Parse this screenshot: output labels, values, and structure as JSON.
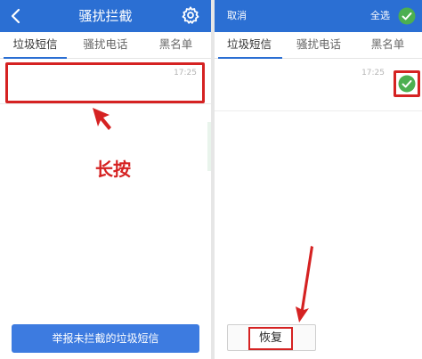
{
  "left_screen": {
    "header": {
      "title": "骚扰拦截",
      "back_icon": "chevron-left-icon",
      "settings_icon": "gear-icon"
    },
    "tabs": [
      {
        "label": "垃圾短信",
        "active": true
      },
      {
        "label": "骚扰电话",
        "active": false
      },
      {
        "label": "黑名单",
        "active": false
      }
    ],
    "message": {
      "time": "17:25"
    },
    "annotation": {
      "text": "长按"
    },
    "report_button": {
      "label": "举报未拦截的垃圾短信"
    }
  },
  "right_screen": {
    "header": {
      "cancel_label": "取消",
      "select_all_label": "全选",
      "select_all_icon": "check-circle-icon"
    },
    "tabs": [
      {
        "label": "垃圾短信",
        "active": true
      },
      {
        "label": "骚扰电话",
        "active": false
      },
      {
        "label": "黑名单",
        "active": false
      }
    ],
    "message": {
      "time": "17:25",
      "selected_icon": "check-circle-icon"
    },
    "restore_button": {
      "label": "恢复"
    }
  },
  "colors": {
    "header_blue": "#2b6fd3",
    "button_blue": "#3d7be0",
    "annotation_red": "#d52222",
    "check_green": "#4caf50"
  }
}
